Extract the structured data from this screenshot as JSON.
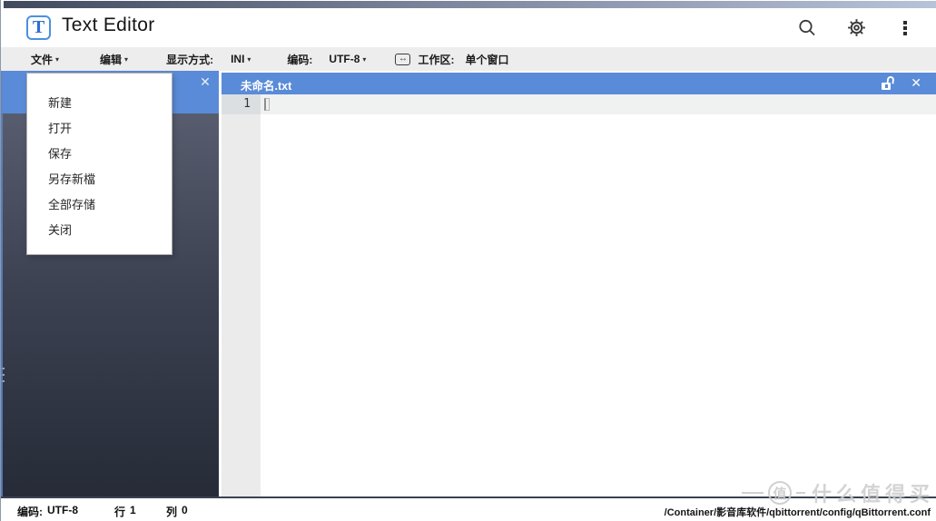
{
  "app": {
    "window_title": "Text Editor",
    "logo_letter": "T"
  },
  "toolbar": {
    "file_label": "文件",
    "edit_label": "编辑",
    "display_mode_label": "显示方式:",
    "display_mode_value": "INI",
    "encoding_label": "编码:",
    "encoding_value": "UTF-8",
    "workspace_label": "工作区:",
    "workspace_value": "单个窗口"
  },
  "icons": {
    "dropdown_caret": "▾",
    "close_glyph": "✕",
    "workspace_glyph": "↔"
  },
  "file_menu": {
    "items": [
      "新建",
      "打开",
      "保存",
      "另存新檔",
      "全部存储",
      "关闭"
    ]
  },
  "editor": {
    "tab_title": "未命名.txt",
    "active_line_number": "1"
  },
  "status_bar": {
    "encoding_label": "编码:",
    "encoding_value": "UTF-8",
    "line_label": "行",
    "line_value": "1",
    "column_label": "列",
    "column_value": "0",
    "file_path": "/Container/影音库软件/qbittorrent/config/qBittorrent.conf"
  },
  "watermark": {
    "badge": "值",
    "text": "什么值得买"
  },
  "colors": {
    "accent_blue": "#5a8bd8",
    "topbar_gradient_left": "#414a5d",
    "topbar_gradient_right": "#b7c3d8",
    "sidebar_top": "#575d6e",
    "sidebar_bottom": "#262b37",
    "toolbar_bg": "#ededed"
  }
}
